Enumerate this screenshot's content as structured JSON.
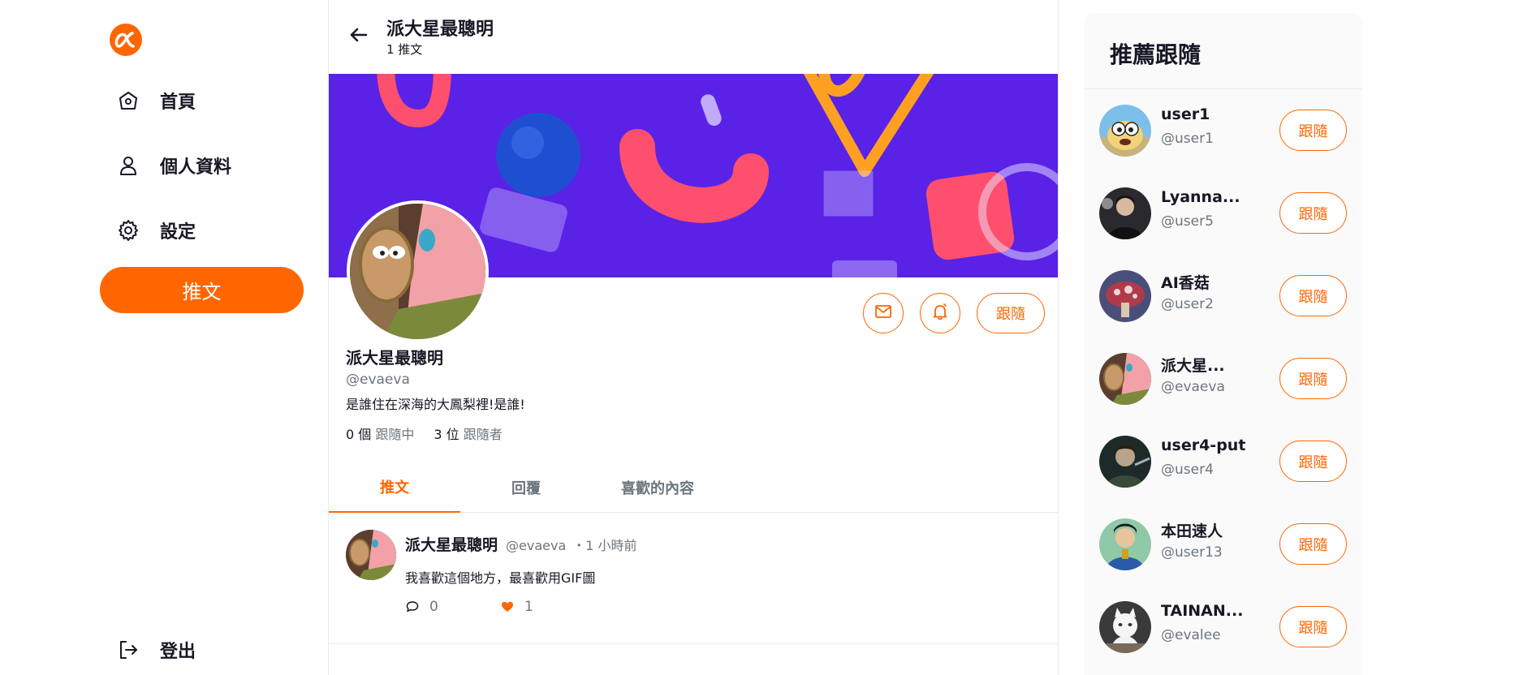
{
  "colors": {
    "accent": "#ff6600",
    "cover": "#5a22e6",
    "text": "#171725",
    "muted": "#6c757d"
  },
  "sidebar": {
    "logo": "alpha-logo-icon",
    "items": [
      {
        "label": "首頁",
        "icon": "home-icon"
      },
      {
        "label": "個人資料",
        "icon": "user-icon"
      },
      {
        "label": "設定",
        "icon": "gear-icon"
      }
    ],
    "tweet_button": "推文",
    "logout": {
      "label": "登出",
      "icon": "logout-icon"
    }
  },
  "header": {
    "name": "派大星最聰明",
    "tweet_count": "1 推文"
  },
  "profile": {
    "name": "派大星最聰明",
    "handle": "@evaeva",
    "bio": "是誰住在深海的大鳳梨裡!是誰!",
    "following_num": "0 個",
    "following_label": "跟隨中",
    "followers_num": "3 位",
    "followers_label": "跟隨者",
    "follow_label": "跟隨"
  },
  "tabs": [
    {
      "label": "推文",
      "active": true
    },
    {
      "label": "回覆",
      "active": false
    },
    {
      "label": "喜歡的內容",
      "active": false
    }
  ],
  "tweet": {
    "name": "派大星最聰明",
    "handle": "@evaeva",
    "time": "・1 小時前",
    "text": "我喜歡這個地方，最喜歡用GIF圖",
    "reply_count": "0",
    "like_count": "1"
  },
  "suggest": {
    "title": "推薦跟隨",
    "follow_label": "跟隨",
    "users": [
      {
        "name": "user1",
        "handle": "@user1"
      },
      {
        "name": "Lyanna...",
        "handle": "@user5"
      },
      {
        "name": "AI香菇",
        "handle": "@user2"
      },
      {
        "name": "派大星...",
        "handle": "@evaeva"
      },
      {
        "name": "user4-put",
        "handle": "@user4"
      },
      {
        "name": "本田速人",
        "handle": "@user13"
      },
      {
        "name": "TAINAN...",
        "handle": "@evalee"
      }
    ]
  }
}
